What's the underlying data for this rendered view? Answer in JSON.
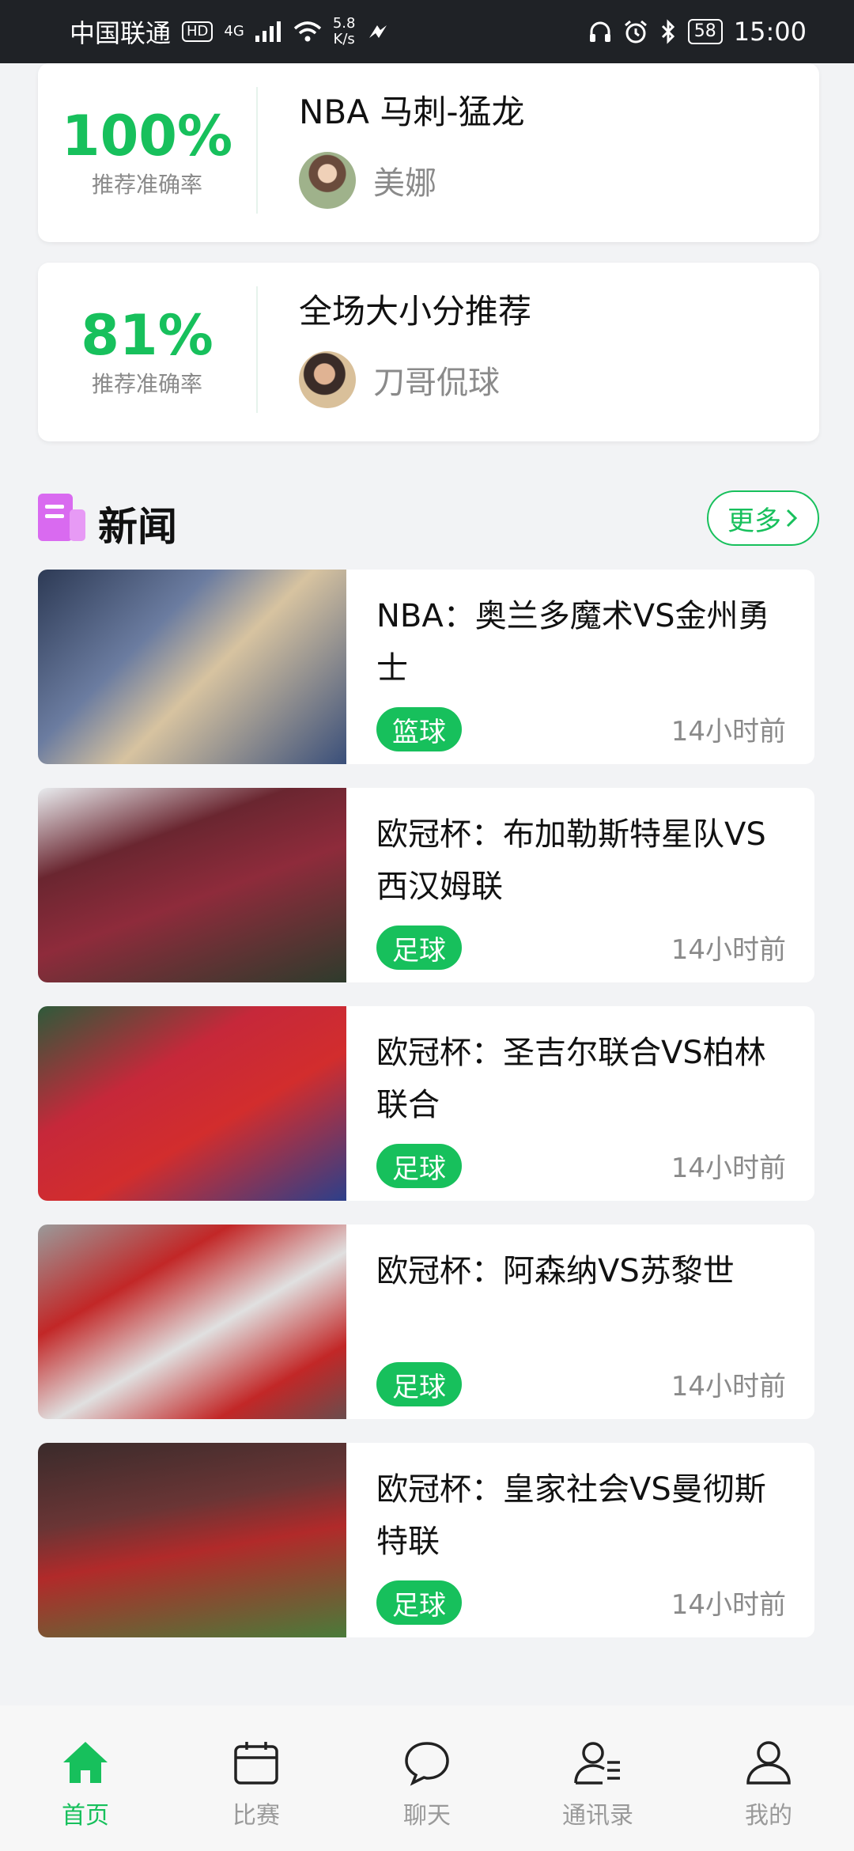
{
  "status_bar": {
    "carrier": "中国联通",
    "hd": "HD",
    "net_type": "4G",
    "speed_value": "5.8",
    "speed_unit": "K/s",
    "battery": "58",
    "time": "15:00"
  },
  "recommendations": [
    {
      "percent": "100%",
      "percent_label": "推荐准确率",
      "title": "NBA 马刺-猛龙",
      "author": "美娜"
    },
    {
      "percent": "81%",
      "percent_label": "推荐准确率",
      "title": "全场大小分推荐",
      "author": "刀哥侃球"
    }
  ],
  "news_section": {
    "title": "新闻",
    "more_label": "更多",
    "items": [
      {
        "title": "NBA：奥兰多魔术VS金州勇士",
        "tag": "篮球",
        "time": "14小时前"
      },
      {
        "title": "欧冠杯：布加勒斯特星队VS西汉姆联",
        "tag": "足球",
        "time": "14小时前"
      },
      {
        "title": "欧冠杯：圣吉尔联合VS柏林联合",
        "tag": "足球",
        "time": "14小时前"
      },
      {
        "title": "欧冠杯：阿森纳VS苏黎世",
        "tag": "足球",
        "time": "14小时前"
      },
      {
        "title": "欧冠杯：皇家社会VS曼彻斯特联",
        "tag": "足球",
        "time": "14小时前"
      }
    ]
  },
  "bottom_nav": [
    {
      "label": "首页",
      "icon": "home-icon",
      "active": true
    },
    {
      "label": "比赛",
      "icon": "calendar-icon",
      "active": false
    },
    {
      "label": "聊天",
      "icon": "chat-bubble-icon",
      "active": false
    },
    {
      "label": "通讯录",
      "icon": "contacts-icon",
      "active": false
    },
    {
      "label": "我的",
      "icon": "profile-icon",
      "active": false
    }
  ],
  "colors": {
    "accent": "#17c05c",
    "news_icon": "#d96af0",
    "status_bar_bg": "#1f2226",
    "page_bg": "#f2f3f5"
  }
}
